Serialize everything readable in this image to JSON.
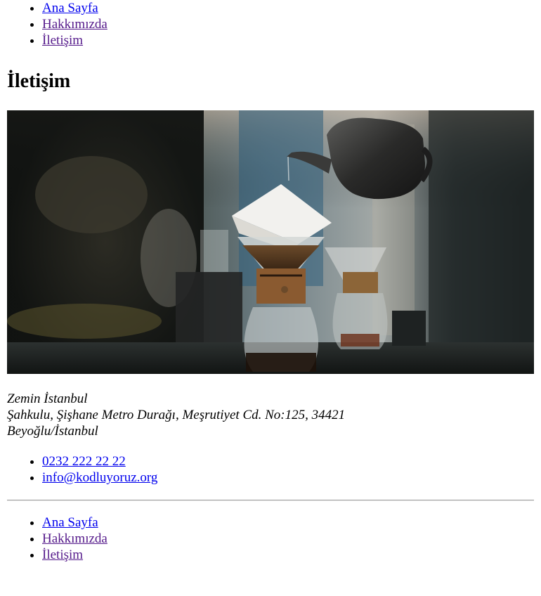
{
  "nav": {
    "items": [
      {
        "label": "Ana Sayfa",
        "visited": false
      },
      {
        "label": "Hakkımızda",
        "visited": true
      },
      {
        "label": "İletişim",
        "visited": true
      }
    ]
  },
  "page": {
    "title": "İletişim"
  },
  "hero": {
    "alt": "coffee brewing with chemex and kettle"
  },
  "address": {
    "line1": "Zemin İstanbul",
    "line2": "Şahkulu, Şişhane Metro Durağı, Meşrutiyet Cd. No:125, 34421",
    "line3": "Beyoğlu/İstanbul"
  },
  "contacts": {
    "phone": "0232 222 22 22",
    "email": "info@kodluyoruz.org"
  },
  "footer_nav": {
    "items": [
      {
        "label": "Ana Sayfa",
        "visited": false
      },
      {
        "label": "Hakkımızda",
        "visited": true
      },
      {
        "label": "İletişim",
        "visited": true
      }
    ]
  }
}
